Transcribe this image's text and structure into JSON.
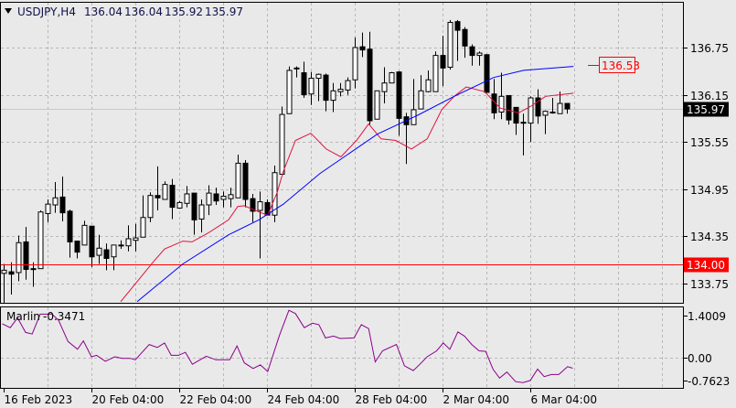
{
  "header": {
    "symbol_timeframe": "USDJPY,H4",
    "open": "136.04",
    "high": "136.04",
    "low": "135.92",
    "close": "135.97"
  },
  "colors": {
    "background": "#e9e9e9",
    "grid": "#b8b8b8",
    "ma_fast": "#e0103c",
    "ma_slow": "#0000ff",
    "oscillator": "#8b008b",
    "level_line": "#ff0000",
    "bull_body": "#ffffff",
    "bear_body": "#000000"
  },
  "chart_data": {
    "type": "candlestick",
    "title": "USDJPY,H4",
    "ylim": [
      133.55,
      137.35
    ],
    "yticks": [
      "136.75",
      "136.15",
      "135.55",
      "134.95",
      "134.35",
      "133.75"
    ],
    "xticks": [
      {
        "index": 0,
        "label": "16 Feb 2023"
      },
      {
        "index": 12,
        "label": "20 Feb 04:00"
      },
      {
        "index": 24,
        "label": "22 Feb 04:00"
      },
      {
        "index": 36,
        "label": "24 Feb 04:00"
      },
      {
        "index": 48,
        "label": "28 Feb 04:00"
      },
      {
        "index": 60,
        "label": "2 Mar 04:00"
      },
      {
        "index": 72,
        "label": "6 Mar 04:00"
      }
    ],
    "candles_ohlc": [
      [
        133.88,
        134.0,
        133.5,
        133.92
      ],
      [
        133.9,
        134.02,
        133.61,
        133.87
      ],
      [
        133.89,
        134.36,
        133.78,
        134.27
      ],
      [
        134.28,
        134.47,
        133.8,
        133.93
      ],
      [
        133.93,
        134.02,
        133.71,
        133.94
      ],
      [
        133.94,
        134.68,
        133.94,
        134.66
      ],
      [
        134.64,
        134.82,
        134.53,
        134.76
      ],
      [
        134.75,
        135.04,
        134.65,
        134.84
      ],
      [
        134.85,
        135.11,
        134.54,
        134.65
      ],
      [
        134.67,
        134.69,
        134.08,
        134.28
      ],
      [
        134.29,
        134.29,
        134.07,
        134.15
      ],
      [
        134.24,
        134.55,
        134.24,
        134.49
      ],
      [
        134.48,
        134.48,
        133.96,
        134.09
      ],
      [
        134.11,
        134.37,
        134.0,
        134.2
      ],
      [
        134.18,
        134.26,
        133.92,
        134.07
      ],
      [
        134.09,
        134.24,
        133.92,
        134.24
      ],
      [
        134.24,
        134.3,
        134.19,
        134.24
      ],
      [
        134.23,
        134.49,
        134.16,
        134.32
      ],
      [
        134.3,
        134.51,
        134.16,
        134.33
      ],
      [
        134.34,
        134.87,
        134.34,
        134.59
      ],
      [
        134.59,
        134.91,
        134.53,
        134.87
      ],
      [
        134.87,
        135.24,
        134.68,
        134.84
      ],
      [
        134.82,
        135.05,
        134.82,
        135.01
      ],
      [
        135.0,
        135.08,
        134.57,
        134.72
      ],
      [
        134.71,
        134.8,
        134.7,
        134.78
      ],
      [
        134.77,
        134.99,
        134.72,
        134.89
      ],
      [
        134.9,
        134.9,
        134.37,
        134.56
      ],
      [
        134.57,
        134.82,
        134.4,
        134.75
      ],
      [
        134.75,
        135.0,
        134.62,
        134.9
      ],
      [
        134.89,
        134.97,
        134.75,
        134.8
      ],
      [
        134.82,
        134.92,
        134.72,
        134.86
      ],
      [
        134.83,
        134.97,
        134.72,
        134.88
      ],
      [
        134.84,
        135.39,
        134.84,
        135.28
      ],
      [
        135.28,
        135.32,
        134.72,
        134.82
      ],
      [
        134.83,
        134.89,
        134.53,
        134.67
      ],
      [
        134.68,
        134.92,
        134.07,
        134.79
      ],
      [
        134.78,
        134.82,
        134.62,
        134.62
      ],
      [
        134.62,
        135.25,
        134.53,
        135.16
      ],
      [
        135.14,
        136.0,
        135.14,
        135.9
      ],
      [
        135.91,
        136.51,
        135.91,
        136.46
      ],
      [
        136.49,
        136.51,
        136.37,
        136.49
      ],
      [
        136.43,
        136.57,
        136.11,
        136.15
      ],
      [
        136.16,
        136.44,
        136.02,
        136.36
      ],
      [
        136.36,
        136.42,
        136.07,
        136.41
      ],
      [
        136.4,
        136.42,
        135.94,
        136.08
      ],
      [
        136.08,
        136.3,
        135.93,
        136.2
      ],
      [
        136.19,
        136.3,
        136.13,
        136.22
      ],
      [
        136.21,
        136.37,
        136.15,
        136.33
      ],
      [
        136.34,
        136.88,
        136.23,
        136.75
      ],
      [
        136.76,
        136.94,
        136.63,
        136.72
      ],
      [
        136.73,
        136.95,
        135.77,
        135.82
      ],
      [
        135.84,
        136.2,
        135.84,
        136.2
      ],
      [
        136.19,
        136.5,
        136.04,
        136.3
      ],
      [
        136.3,
        136.44,
        136.3,
        136.43
      ],
      [
        136.44,
        136.45,
        135.63,
        135.85
      ],
      [
        135.87,
        135.92,
        135.27,
        135.77
      ],
      [
        135.77,
        136.35,
        135.77,
        135.96
      ],
      [
        135.97,
        136.4,
        135.97,
        136.2
      ],
      [
        136.19,
        136.46,
        136.18,
        136.34
      ],
      [
        136.19,
        136.7,
        136.19,
        136.65
      ],
      [
        136.65,
        136.9,
        136.26,
        136.49
      ],
      [
        136.5,
        137.1,
        136.47,
        137.07
      ],
      [
        137.08,
        137.1,
        136.58,
        136.97
      ],
      [
        136.98,
        137.01,
        136.62,
        136.77
      ],
      [
        136.76,
        136.79,
        136.52,
        136.65
      ],
      [
        136.65,
        136.7,
        136.52,
        136.68
      ],
      [
        136.66,
        136.66,
        136.18,
        136.18
      ],
      [
        136.16,
        136.35,
        135.84,
        135.92
      ],
      [
        135.93,
        136.43,
        135.84,
        136.13
      ],
      [
        136.14,
        136.14,
        135.77,
        135.83
      ],
      [
        135.99,
        135.99,
        135.64,
        135.79
      ],
      [
        135.8,
        135.91,
        135.38,
        135.8
      ],
      [
        135.79,
        136.13,
        135.55,
        136.11
      ],
      [
        136.11,
        136.22,
        135.78,
        135.88
      ],
      [
        135.89,
        135.95,
        135.65,
        135.94
      ],
      [
        135.93,
        136.11,
        135.91,
        135.93
      ],
      [
        135.91,
        136.19,
        135.91,
        136.04
      ],
      [
        136.04,
        136.04,
        135.91,
        135.97
      ]
    ],
    "ma_fast_points": [
      [
        16,
        133.52
      ],
      [
        20.4,
        134.02
      ],
      [
        22,
        134.19
      ],
      [
        24.5,
        134.29
      ],
      [
        25.75,
        134.28
      ],
      [
        27.9,
        134.39
      ],
      [
        30.75,
        134.56
      ],
      [
        32,
        134.73
      ],
      [
        32.9,
        134.74
      ],
      [
        34.9,
        134.66
      ],
      [
        36.1,
        134.62
      ],
      [
        37.4,
        134.91
      ],
      [
        38.25,
        135.18
      ],
      [
        39.9,
        135.57
      ],
      [
        42,
        135.66
      ],
      [
        44.1,
        135.46
      ],
      [
        46.1,
        135.36
      ],
      [
        48.25,
        135.57
      ],
      [
        49.9,
        135.78
      ],
      [
        51.6,
        135.59
      ],
      [
        53.6,
        135.57
      ],
      [
        55.75,
        135.46
      ],
      [
        57.9,
        135.59
      ],
      [
        59.9,
        135.96
      ],
      [
        61.6,
        136.13
      ],
      [
        63.25,
        136.25
      ],
      [
        65.75,
        136.19
      ],
      [
        67.9,
        135.98
      ],
      [
        70.4,
        135.92
      ],
      [
        72,
        136.0
      ],
      [
        74.1,
        136.13
      ],
      [
        77.9,
        136.17
      ]
    ],
    "ma_slow_points": [
      [
        18.25,
        133.52
      ],
      [
        24.5,
        134.0
      ],
      [
        30.75,
        134.37
      ],
      [
        34.9,
        134.56
      ],
      [
        38.25,
        134.76
      ],
      [
        43.25,
        135.15
      ],
      [
        51.1,
        135.65
      ],
      [
        56.6,
        135.89
      ],
      [
        61.6,
        136.13
      ],
      [
        67,
        136.37
      ],
      [
        71.1,
        136.46
      ],
      [
        77.9,
        136.51
      ]
    ],
    "ma_slow_label": "136.53",
    "current_price_label": "135.97",
    "level_line": {
      "price": 134.0,
      "label": "134.00"
    },
    "oscillator": {
      "name": "Marlin",
      "value": "-0.3471",
      "yticks": [
        {
          "value": 1.4009,
          "label": "1.4009"
        },
        {
          "value": 0,
          "label": "0.00"
        },
        {
          "value": -0.7623,
          "label": "-0.7623"
        }
      ],
      "points": [
        [
          -0.2,
          1.13
        ],
        [
          0.9,
          1.0
        ],
        [
          1.9,
          1.33
        ],
        [
          3.0,
          0.84
        ],
        [
          3.9,
          0.79
        ],
        [
          5.0,
          1.45
        ],
        [
          6.6,
          1.45
        ],
        [
          7.5,
          1.25
        ],
        [
          8.8,
          0.54
        ],
        [
          10.1,
          0.28
        ],
        [
          10.9,
          0.56
        ],
        [
          12.0,
          0.03
        ],
        [
          12.7,
          0.08
        ],
        [
          13.9,
          -0.12
        ],
        [
          15.2,
          0.03
        ],
        [
          16.2,
          -0.02
        ],
        [
          17.3,
          -0.02
        ],
        [
          18.0,
          -0.07
        ],
        [
          18.75,
          0.13
        ],
        [
          19.9,
          0.44
        ],
        [
          21.0,
          0.34
        ],
        [
          22.0,
          0.49
        ],
        [
          22.9,
          0.08
        ],
        [
          23.9,
          0.08
        ],
        [
          24.85,
          0.18
        ],
        [
          25.8,
          -0.22
        ],
        [
          26.5,
          -0.12
        ],
        [
          27.7,
          0.05
        ],
        [
          29.0,
          -0.07
        ],
        [
          30.9,
          -0.07
        ],
        [
          31.9,
          0.39
        ],
        [
          32.9,
          -0.17
        ],
        [
          34.1,
          -0.36
        ],
        [
          35.1,
          -0.24
        ],
        [
          36.1,
          -0.46
        ],
        [
          37.7,
          0.74
        ],
        [
          39.0,
          1.58
        ],
        [
          39.9,
          1.47
        ],
        [
          41.1,
          1.0
        ],
        [
          42.2,
          1.15
        ],
        [
          43.1,
          1.1
        ],
        [
          44.0,
          0.66
        ],
        [
          45.1,
          0.72
        ],
        [
          46.0,
          0.64
        ],
        [
          47.9,
          0.66
        ],
        [
          48.9,
          1.1
        ],
        [
          49.9,
          0.97
        ],
        [
          50.8,
          -0.14
        ],
        [
          51.8,
          0.23
        ],
        [
          53.7,
          0.44
        ],
        [
          54.8,
          -0.27
        ],
        [
          56.0,
          -0.43
        ],
        [
          56.9,
          -0.22
        ],
        [
          57.9,
          0.03
        ],
        [
          59.2,
          0.23
        ],
        [
          60.1,
          0.49
        ],
        [
          61.0,
          0.28
        ],
        [
          62.1,
          0.86
        ],
        [
          63.0,
          0.72
        ],
        [
          64.0,
          0.44
        ],
        [
          65.0,
          0.23
        ],
        [
          65.9,
          0.21
        ],
        [
          66.9,
          -0.38
        ],
        [
          67.8,
          -0.68
        ],
        [
          68.8,
          -0.48
        ],
        [
          70.0,
          -0.8
        ],
        [
          71.0,
          -0.83
        ],
        [
          72.0,
          -0.76
        ],
        [
          73.0,
          -0.38
        ],
        [
          73.9,
          -0.63
        ],
        [
          74.9,
          -0.56
        ],
        [
          75.9,
          -0.56
        ],
        [
          77.1,
          -0.3
        ],
        [
          77.8,
          -0.35
        ]
      ]
    }
  }
}
